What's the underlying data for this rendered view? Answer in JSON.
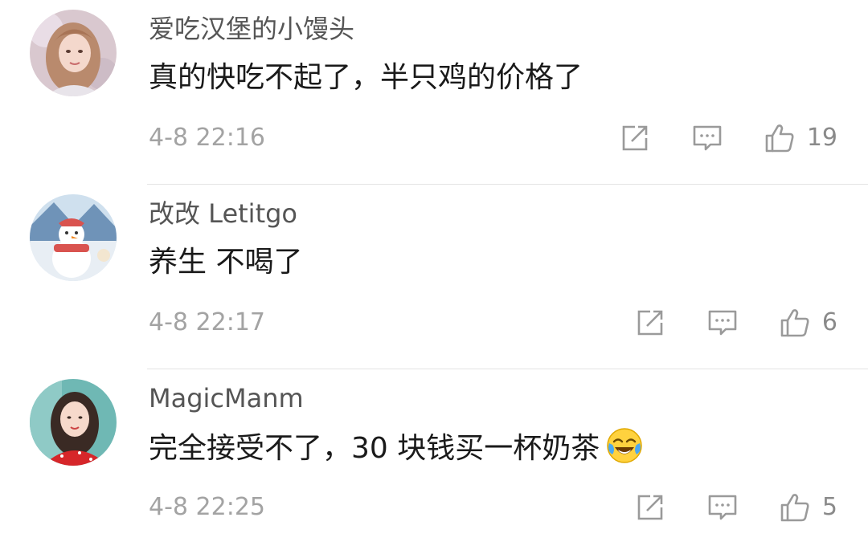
{
  "colors": {
    "username": "#555555",
    "text": "#1a1a1a",
    "meta": "#a3a3a3",
    "icon": "#9a9a9a",
    "divider": "#e4e4e4"
  },
  "comments": [
    {
      "username": "爱吃汉堡的小馒头",
      "text": "真的快吃不起了，半只鸡的价格了",
      "timestamp": "4-8 22:16",
      "likes": "19",
      "avatar": "avatar-woman-light-hair"
    },
    {
      "username": "改改 Letitgo",
      "text": "养生 不喝了",
      "timestamp": "4-8 22:17",
      "likes": "6",
      "avatar": "avatar-snowman"
    },
    {
      "username": "MagicManm",
      "text": "完全接受不了，30 块钱买一杯奶茶",
      "timestamp": "4-8 22:25",
      "likes": "5",
      "avatar": "avatar-woman-red-dress",
      "emoji": "crying-laughing-emoji"
    }
  ]
}
